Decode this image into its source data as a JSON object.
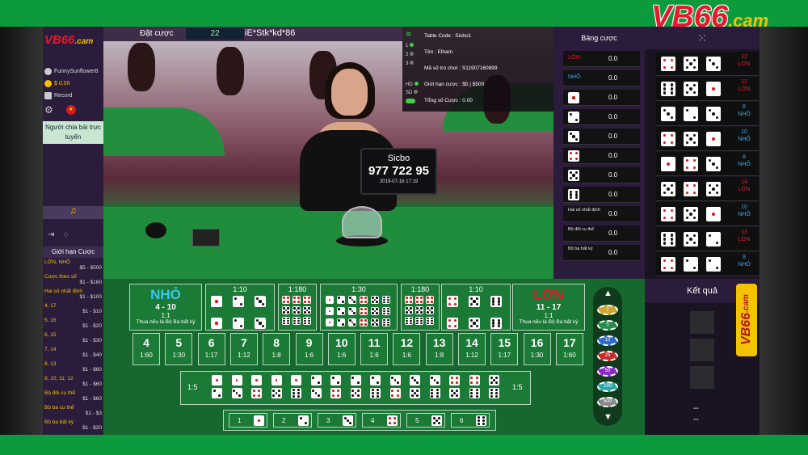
{
  "brand": {
    "logo_main": "VB66",
    "logo_suffix": ".cam"
  },
  "left_panel": {
    "username": "FunnySunflower8",
    "balance": "$ 0.00",
    "record_label": "Record",
    "dealer_label": "Người chia bài trực tuyến",
    "limits_title": "Giới hạn Cược",
    "limits": [
      {
        "name": "LỚN, NHỎ",
        "value": "$5 - $500"
      },
      {
        "name": "Cược theo số",
        "value": "$1 - $160"
      },
      {
        "name": "Hai số nhất định",
        "value": "$1 - $100"
      },
      {
        "name": "4, 17",
        "value": "$1 - $10"
      },
      {
        "name": "5, 16",
        "value": "$1 - $20"
      },
      {
        "name": "6, 15",
        "value": "$1 - $30"
      },
      {
        "name": "7, 14",
        "value": "$1 - $40"
      },
      {
        "name": "8, 13",
        "value": "$1 - $60"
      },
      {
        "name": "9, 10, 11, 12",
        "value": "$1 - $60"
      },
      {
        "name": "Bộ đôi cụ thể",
        "value": "$1 - $60"
      },
      {
        "name": "Bộ ba cụ thể",
        "value": "$1 - $3"
      },
      {
        "name": "Bộ ba bất kỳ",
        "value": "$1 - $20"
      }
    ]
  },
  "video_hud": {
    "bet_label": "Đặt cược",
    "countdown": "22",
    "user_mask": "iE*Stk*kd*86"
  },
  "table_info": {
    "signal_rows": [
      "1",
      "2",
      "3"
    ],
    "quality": [
      "HD",
      "SD"
    ],
    "rows": [
      "Table Code : Sicbo1",
      "Tên : Elham",
      "Mã số trò chơi : S11907160899",
      "Giới hạn cược : $5 | $500",
      "Tổng số Cược : 0.00"
    ]
  },
  "sicbo_sign": {
    "title": "Sicbo",
    "number": "977 722 95",
    "date": "2019-07-16 17:19"
  },
  "bet_list": {
    "title": "Bảng cược",
    "items": [
      {
        "label": "LỚN",
        "value": "0.0",
        "color": "#e8192c"
      },
      {
        "label": "NHỎ",
        "value": "0.0",
        "color": "#38a8e8"
      },
      {
        "die": 1,
        "value": "0.0"
      },
      {
        "die": 2,
        "value": "0.0"
      },
      {
        "die": 3,
        "value": "0.0"
      },
      {
        "die": 4,
        "value": "0.0"
      },
      {
        "die": 5,
        "value": "0.0"
      },
      {
        "die": 6,
        "value": "0.0"
      },
      {
        "label": "Hai số nhất định",
        "value": "0.0"
      },
      {
        "label": "Bộ đôi cụ thể",
        "value": "0.0"
      },
      {
        "label": "Bộ ba bất kỳ",
        "value": "0.0"
      }
    ]
  },
  "history": {
    "rows": [
      {
        "dice": [
          4,
          5,
          3
        ],
        "sum": "12",
        "result": "LỚN",
        "color": "#e8192c"
      },
      {
        "dice": [
          6,
          5,
          1
        ],
        "sum": "12",
        "result": "LỚN",
        "color": "#e8192c"
      },
      {
        "dice": [
          3,
          2,
          3
        ],
        "sum": "8",
        "result": "NHỎ",
        "color": "#38a8e8"
      },
      {
        "dice": [
          4,
          5,
          1
        ],
        "sum": "10",
        "result": "NHỎ",
        "color": "#38a8e8"
      },
      {
        "dice": [
          1,
          4,
          3
        ],
        "sum": "8",
        "result": "NHỎ",
        "color": "#38a8e8"
      },
      {
        "dice": [
          5,
          4,
          5
        ],
        "sum": "14",
        "result": "LỚN",
        "color": "#e8192c"
      },
      {
        "dice": [
          4,
          5,
          1
        ],
        "sum": "10",
        "result": "NHỎ",
        "color": "#38a8e8"
      },
      {
        "dice": [
          6,
          5,
          2
        ],
        "sum": "13",
        "result": "LỚN",
        "color": "#e8192c"
      },
      {
        "dice": [
          4,
          2,
          2
        ],
        "sum": "8",
        "result": "NHỎ",
        "color": "#38a8e8"
      }
    ]
  },
  "result": {
    "title": "Kết quả",
    "dash1": "--",
    "dash2": "--"
  },
  "board": {
    "small": {
      "title": "NHỎ",
      "range": "4 - 10",
      "odds": "1:1",
      "note": "Thua nếu là Bộ Ba bất kỳ"
    },
    "big": {
      "title": "LỚN",
      "range": "11 - 17",
      "odds": "1:1",
      "note": "Thua nếu là Bộ Ba bất kỳ"
    },
    "pairs_odds": "1:10",
    "triples_odds": "1:180",
    "any_triple_odds": "1:30",
    "triples_odds2": "1:180",
    "pairs_odds2": "1:10",
    "totals": [
      {
        "n": "4",
        "o": "1:60"
      },
      {
        "n": "5",
        "o": "1:30"
      },
      {
        "n": "6",
        "o": "1:17"
      },
      {
        "n": "7",
        "o": "1:12"
      },
      {
        "n": "8",
        "o": "1:8"
      },
      {
        "n": "9",
        "o": "1:6"
      },
      {
        "n": "10",
        "o": "1:6"
      },
      {
        "n": "11",
        "o": "1:6"
      },
      {
        "n": "12",
        "o": "1:6"
      },
      {
        "n": "13",
        "o": "1:8"
      },
      {
        "n": "14",
        "o": "1:12"
      },
      {
        "n": "15",
        "o": "1:17"
      },
      {
        "n": "16",
        "o": "1:30"
      },
      {
        "n": "17",
        "o": "1:60"
      }
    ],
    "combo_odds": "1:5",
    "singles": [
      "1",
      "2",
      "3",
      "4",
      "5",
      "6"
    ],
    "chips": [
      "1",
      "5",
      "10",
      "25",
      "50",
      "100",
      "500"
    ]
  }
}
